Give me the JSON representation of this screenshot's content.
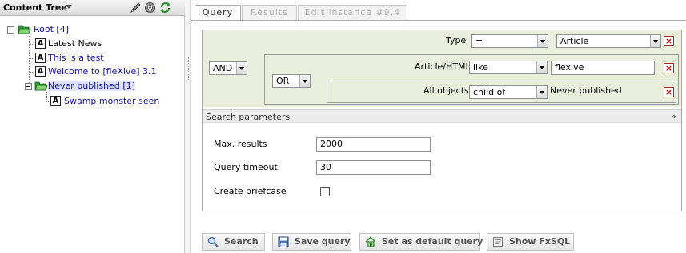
{
  "tree": {
    "title": "Content Tree",
    "nodes": [
      {
        "label": "Root [4]",
        "kind": "folder"
      },
      {
        "label": "Latest News",
        "kind": "article"
      },
      {
        "label": "This is a test",
        "kind": "article"
      },
      {
        "label": "Welcome to [fleXive] 3.1",
        "kind": "article"
      },
      {
        "label": "Never published [1]",
        "kind": "folder"
      },
      {
        "label": "Swamp monster seen",
        "kind": "article"
      }
    ]
  },
  "tabs": [
    {
      "label": "Query",
      "active": true
    },
    {
      "label": "Results",
      "active": false
    },
    {
      "label": "Edit instance #9.4",
      "active": false
    }
  ],
  "query": {
    "root_operator": "AND",
    "type_label": "Type",
    "type_operator": "=",
    "type_value": "Article",
    "sub_operator": "OR",
    "field_label": "Article/HTML",
    "field_operator": "like",
    "field_value": "flexive",
    "tree_label": "All objects",
    "tree_operator": "child of",
    "tree_value": "Never published"
  },
  "params": {
    "title": "Search parameters",
    "collapse": "«",
    "max_results_label": "Max. results",
    "max_results_value": "2000",
    "timeout_label": "Query timeout",
    "timeout_value": "30",
    "briefcase_label": "Create briefcase",
    "briefcase_checked": false
  },
  "buttons": {
    "search": "Search",
    "save": "Save query",
    "default": "Set as default query",
    "fxsql": "Show FxSQL"
  },
  "colors": {
    "condition_bg": "#eaeedd",
    "link_blue": "#1010a8",
    "delete_red": "#d00000"
  }
}
